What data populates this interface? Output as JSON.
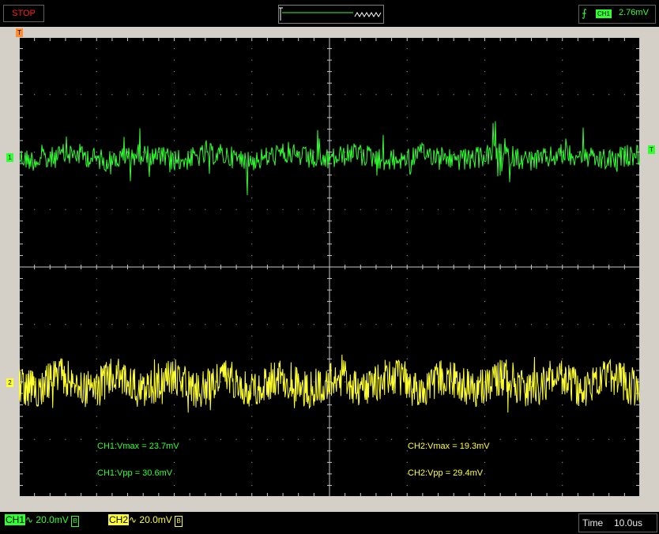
{
  "status": {
    "label": "STOP",
    "color": "#ff2020"
  },
  "trigger": {
    "edge_icon": "rising-edge-icon",
    "channel": "CH1",
    "level": "2.76mV",
    "level_marker": "T",
    "position_marker": "T"
  },
  "channels": [
    {
      "marker": "1",
      "label": "CH1",
      "coupling": "∿",
      "scale": "20.0mV",
      "bw": "B",
      "color": "#30ff30"
    },
    {
      "marker": "2",
      "label": "CH2",
      "coupling": "∿",
      "scale": "20.0mV",
      "bw": "B",
      "color": "#ffff30"
    }
  ],
  "measurements": [
    {
      "text": "CH1:Vmax = 23.7mV",
      "color": "#30ff30"
    },
    {
      "text": "CH1:Vpp = 30.6mV",
      "color": "#30ff30"
    },
    {
      "text": "CH2:Vmax = 19.3mV",
      "color": "#ffff30"
    },
    {
      "text": "CH2:Vpp = 29.4mV",
      "color": "#ffff30"
    }
  ],
  "timebase": {
    "label": "Time",
    "value": "10.0us"
  },
  "grid": {
    "h_divs": 8,
    "v_divs": 8
  }
}
